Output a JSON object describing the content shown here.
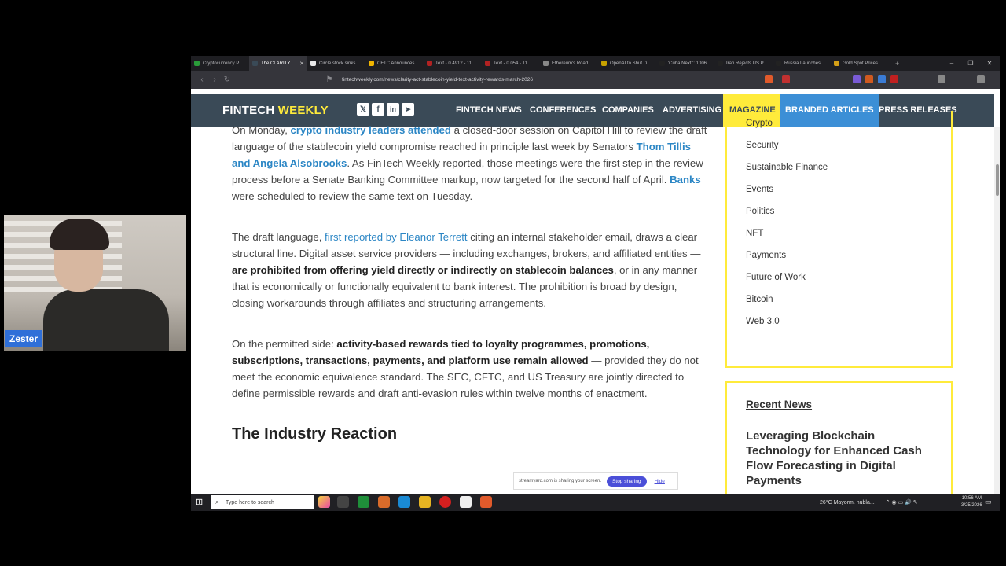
{
  "browser": {
    "tabs": [
      {
        "label": "Cryptocurrency P",
        "color": "#2a9d3a"
      },
      {
        "label": "The CLARITY",
        "color": "#3a4a57",
        "active": true
      },
      {
        "label": "Circle stock sinks",
        "color": "#e8e8e8"
      },
      {
        "label": "CFTC Announces",
        "color": "#f0b400"
      },
      {
        "label": "Text - 0.4912 - 11",
        "color": "#b22222"
      },
      {
        "label": "Text - 0.054 - 11",
        "color": "#b22222"
      },
      {
        "label": "Ethereum's Road",
        "color": "#888888"
      },
      {
        "label": "OpenAI to Shut D",
        "color": "#c8a200"
      },
      {
        "label": "'Cuba Next!': 1006",
        "color": "#222222"
      },
      {
        "label": "Iran Rejects US P",
        "color": "#222222"
      },
      {
        "label": "Russia Launches",
        "color": "#222222"
      },
      {
        "label": "Gold Spot Prices",
        "color": "#d4a017"
      }
    ],
    "url": "fintechweekly.com/news/clarity-act-stablecoin-yield-text-activity-rewards-march-2026"
  },
  "site": {
    "logo_part1": "FINTECH",
    "logo_part2": "WEEKLY",
    "nav": {
      "news": "FINTECH NEWS",
      "conferences": "CONFERENCES",
      "companies": "COMPANIES",
      "advertising": "ADVERTISING",
      "magazine": "MAGAZINE",
      "branded": "BRANDED ARTICLES",
      "press": "PRESS RELEASES"
    }
  },
  "article": {
    "p1_a": "On Monday, ",
    "p1_link1": "crypto industry leaders attended",
    "p1_b": " a closed-door session on Capitol Hill to review the draft language of the stablecoin yield compromise reached in principle last week by Senators ",
    "p1_link2": "Thom Tillis and Angela Alsobrooks",
    "p1_c": ". As FinTech Weekly reported, those meetings were the first step in the review process before a Senate Banking Committee markup, now targeted for the second half of April. ",
    "p1_link3": "Banks",
    "p1_d": " were scheduled to review the same text on Tuesday.",
    "p2_a": "The draft language, ",
    "p2_link": "first reported by Eleanor Terrett",
    "p2_b": " citing an internal stakeholder email, draws a clear structural line. Digital asset service providers — including exchanges, brokers, and affiliated entities — ",
    "p2_bold": "are prohibited from offering yield directly or indirectly on stablecoin balances",
    "p2_c": ", or in any manner that is economically or functionally equivalent to bank interest. The prohibition is broad by design, closing workarounds through affiliates and structuring arrangements.",
    "p3_a": "On the permitted side: ",
    "p3_bold": "activity-based rewards tied to loyalty programmes, promotions, subscriptions, transactions, payments, and platform use remain allowed",
    "p3_b": " — provided they do not meet the economic equivalence standard. The SEC, CFTC, and US Treasury are jointly directed to define permissible rewards and draft anti-evasion rules within twelve months of enactment.",
    "heading": "The Industry Reaction"
  },
  "sidebar": {
    "categories": [
      "Crypto",
      "Security",
      "Sustainable Finance",
      "Events",
      "Politics",
      "NFT",
      "Payments",
      "Future of Work",
      "Bitcoin",
      "Web 3.0"
    ],
    "recent_title": "Recent News",
    "recent_item": "Leveraging Blockchain Technology for Enhanced Cash Flow Forecasting in Digital Payments"
  },
  "share": {
    "text": "streamyard.com is sharing your screen.",
    "stop": "Stop sharing",
    "hide": "Hide"
  },
  "taskbar": {
    "search_placeholder": "Type here to search",
    "weather": "26°C  Mayorm. nubla...",
    "time": "10:56 AM",
    "date": "3/25/2026"
  },
  "webcam": {
    "name": "Zester"
  }
}
